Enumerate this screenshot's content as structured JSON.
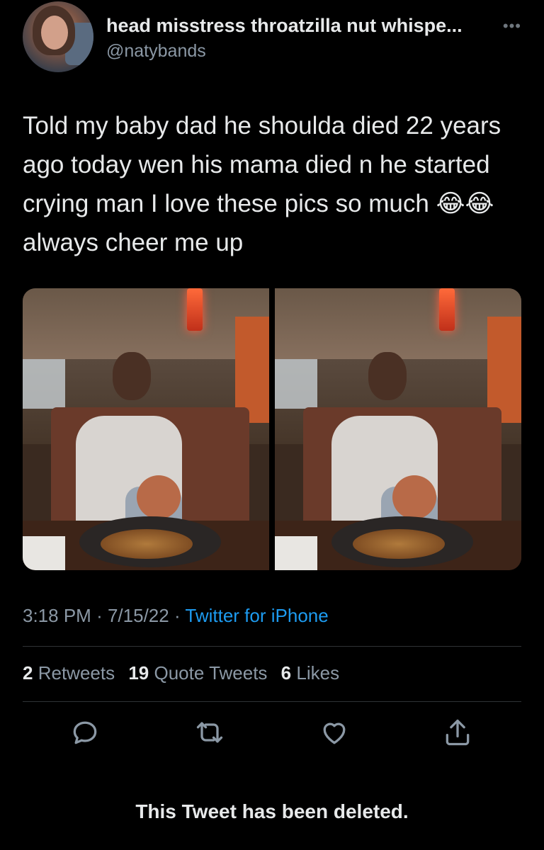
{
  "tweet": {
    "author": {
      "display_name": "head misstress throatzilla nut whispe...",
      "handle": "@natybands"
    },
    "more_icon": "ellipsis-icon",
    "text": "Told my baby dad he shoulda died 22 years ago today wen his mama died n he started crying man I love these pics so much 😂😂 always cheer me up",
    "photos": [
      {
        "label": "photo-1"
      },
      {
        "label": "photo-2"
      }
    ],
    "time": "3:18 PM",
    "date": "7/15/22",
    "separator": "·",
    "source": "Twitter for iPhone",
    "stats": {
      "retweets_count": "2",
      "retweets_label": "Retweets",
      "quote_tweets_count": "19",
      "quote_tweets_label": "Quote Tweets",
      "likes_count": "6",
      "likes_label": "Likes"
    },
    "actions": [
      "reply-icon",
      "retweet-icon",
      "like-icon",
      "share-icon"
    ]
  },
  "deleted_notice": "This Tweet has been deleted.",
  "colors": {
    "background": "#000000",
    "text": "#e7e9ea",
    "secondary": "#8b98a5",
    "link": "#1d9bf0",
    "divider": "#2f3336"
  }
}
